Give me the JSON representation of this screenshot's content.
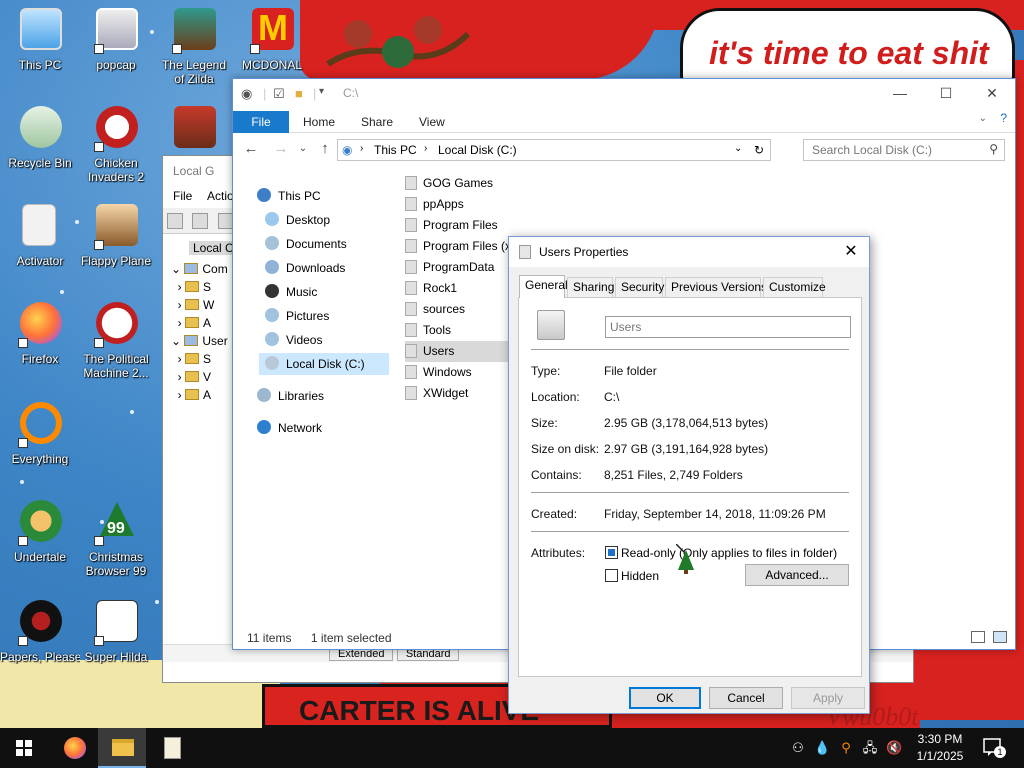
{
  "desktop": {
    "wallpaper_speech": "it's time to eat shit",
    "wallpaper_banner": "CARTER IS ALIVE",
    "wallpaper_signature": "Vwu0b0t",
    "icons": [
      {
        "label": "This PC"
      },
      {
        "label": "popcap"
      },
      {
        "label": "The Legend"
      },
      {
        "label": "of Zilda"
      },
      {
        "label": "MCDONAL"
      },
      {
        "label": "Recycle Bin"
      },
      {
        "label": "Chicken"
      },
      {
        "label": "Invaders 2"
      },
      {
        "label": "Activator"
      },
      {
        "label": "Flappy Plane"
      },
      {
        "label": "Firefox"
      },
      {
        "label": "The Political"
      },
      {
        "label": "Machine 2..."
      },
      {
        "label": "Everything"
      },
      {
        "label": "Undertale"
      },
      {
        "label": "Christmas"
      },
      {
        "label": "Browser 99"
      },
      {
        "label": "Papers, Please"
      },
      {
        "label": "Super Hilda"
      }
    ]
  },
  "back_window": {
    "title": "Local G",
    "menu": [
      "File",
      "Actio"
    ],
    "address": "Local Co",
    "tree": [
      "Com",
      "S",
      "W",
      "A",
      "User",
      "S",
      "V",
      "A"
    ],
    "tabs": [
      "Extended",
      "Standard"
    ]
  },
  "explorer": {
    "title": "C:\\",
    "ribbon_tabs": [
      "File",
      "Home",
      "Share",
      "View"
    ],
    "breadcrumb": [
      "This PC",
      "Local Disk (C:)"
    ],
    "search_placeholder": "Search Local Disk (C:)",
    "nav": {
      "this_pc": "This PC",
      "desktop": "Desktop",
      "documents": "Documents",
      "downloads": "Downloads",
      "music": "Music",
      "pictures": "Pictures",
      "videos": "Videos",
      "local_disk": "Local Disk (C:)",
      "libraries": "Libraries",
      "network": "Network"
    },
    "files": [
      "GOG Games",
      "ppApps",
      "Program Files",
      "Program Files (x",
      "ProgramData",
      "Rock1",
      "sources",
      "Tools",
      "Users",
      "Windows",
      "XWidget"
    ],
    "status": {
      "items": "11 items",
      "selected": "1 item selected"
    }
  },
  "properties": {
    "title": "Users Properties",
    "tabs": [
      "General",
      "Sharing",
      "Security",
      "Previous Versions",
      "Customize"
    ],
    "name": "Users",
    "type_label": "Type:",
    "type_value": "File folder",
    "location_label": "Location:",
    "location_value": "C:\\",
    "size_label": "Size:",
    "size_value": "2.95 GB (3,178,064,513 bytes)",
    "size_on_disk_label": "Size on disk:",
    "size_on_disk_value": "2.97 GB (3,191,164,928 bytes)",
    "contains_label": "Contains:",
    "contains_value": "8,251 Files, 2,749 Folders",
    "created_label": "Created:",
    "created_value": "Friday, September 14, 2018, 11:09:26 PM",
    "attributes_label": "Attributes:",
    "readonly_label": "Read-only (Only applies to files in folder)",
    "hidden_label": "Hidden",
    "advanced_button": "Advanced...",
    "ok_button": "OK",
    "cancel_button": "Cancel",
    "apply_button": "Apply"
  },
  "taskbar": {
    "time": "3:30 PM",
    "date": "1/1/2025",
    "notification_count": "1"
  },
  "colors": {
    "accent": "#1979ca",
    "selection": "#cce8ff",
    "taskbar": "#101010"
  }
}
